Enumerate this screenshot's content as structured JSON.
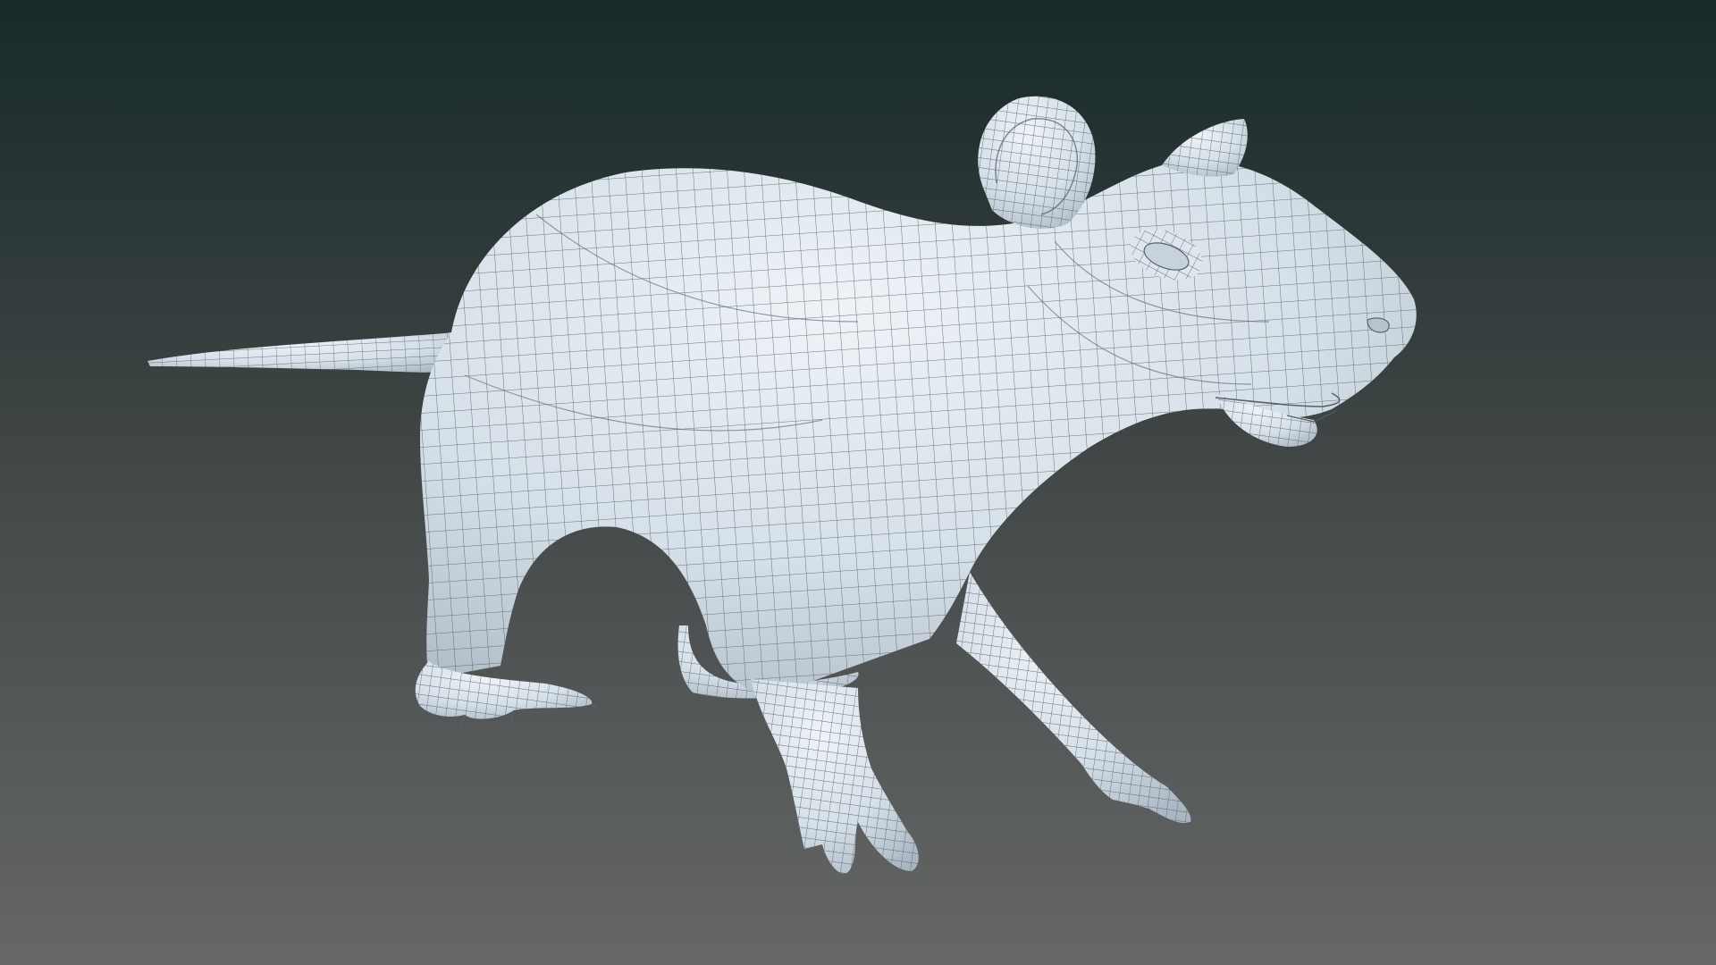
{
  "viewport": {
    "background_top": "#172a29",
    "background_mid": "#3f4545",
    "background_bottom": "#666767",
    "model_fill": "#d6e0e8",
    "model_shadow": "#a9b6c2",
    "wire_color": "#56606b"
  },
  "model": {
    "icon": "rat-wireframe-model-icon"
  }
}
